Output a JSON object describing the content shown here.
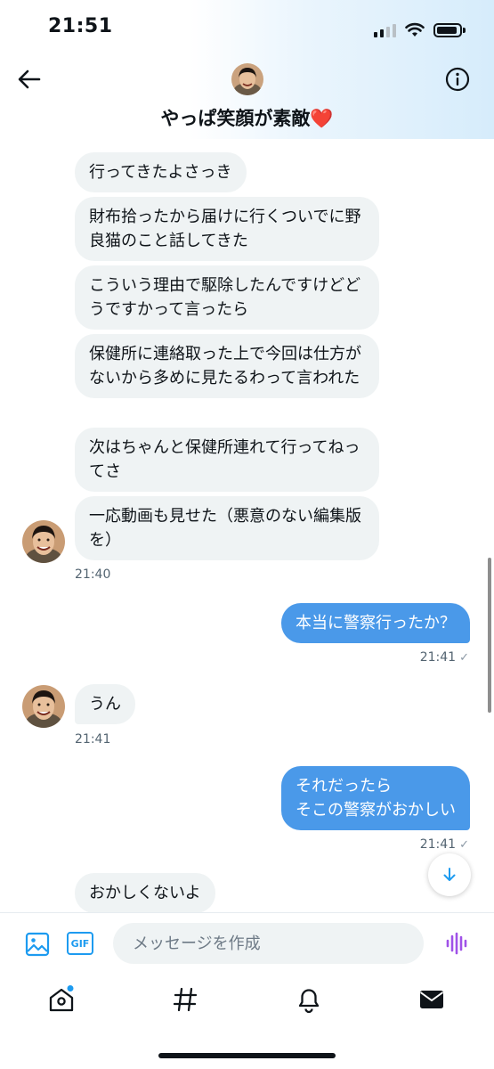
{
  "status_bar": {
    "time": "21:51",
    "icons": [
      "cellular-signal-icon",
      "wifi-icon",
      "battery-icon"
    ]
  },
  "header": {
    "title": "やっぱ笑顔が素敵❤️",
    "back_icon": "arrow-left-icon",
    "info_icon": "info-circle-icon"
  },
  "messages": [
    {
      "side": "in",
      "text": "行ってきたよさっき"
    },
    {
      "side": "in",
      "text": "財布拾ったから届けに行くついでに野良猫のこと話してきた"
    },
    {
      "side": "in",
      "text": "こういう理由で駆除したんですけどどうですかって言ったら"
    },
    {
      "side": "in",
      "text": "保健所に連絡取った上で今回は仕方がないから多めに見たるわって言われた"
    },
    {
      "side": "in",
      "text": "次はちゃんと保健所連れて行ってねってさ"
    },
    {
      "side": "in",
      "text": "一応動画も見せた（悪意のない編集版を）"
    },
    {
      "side": "in",
      "time": "21:40"
    },
    {
      "side": "out",
      "text": "本当に警察行ったか？",
      "time": "21:41"
    },
    {
      "side": "in",
      "text": "うん",
      "time": "21:41"
    },
    {
      "side": "out",
      "text": "それだったら\nそこの警察がおかしい",
      "time": "21:41"
    },
    {
      "side": "in",
      "text": "おかしくないよ"
    }
  ],
  "composer": {
    "placeholder": "メッセージを作成",
    "gif_label": "GIF",
    "icons": [
      "image-icon",
      "voice-message-icon"
    ]
  },
  "tab_bar": {
    "tabs": [
      "home-icon",
      "hashtag-explore-icon",
      "notifications-bell-icon",
      "messages-envelope-icon"
    ]
  },
  "colors": {
    "accent": "#1d9bf0",
    "outgoing_bubble": "#4a99e9",
    "incoming_bubble": "#eff3f4",
    "voice_icon": "#a052e8"
  }
}
